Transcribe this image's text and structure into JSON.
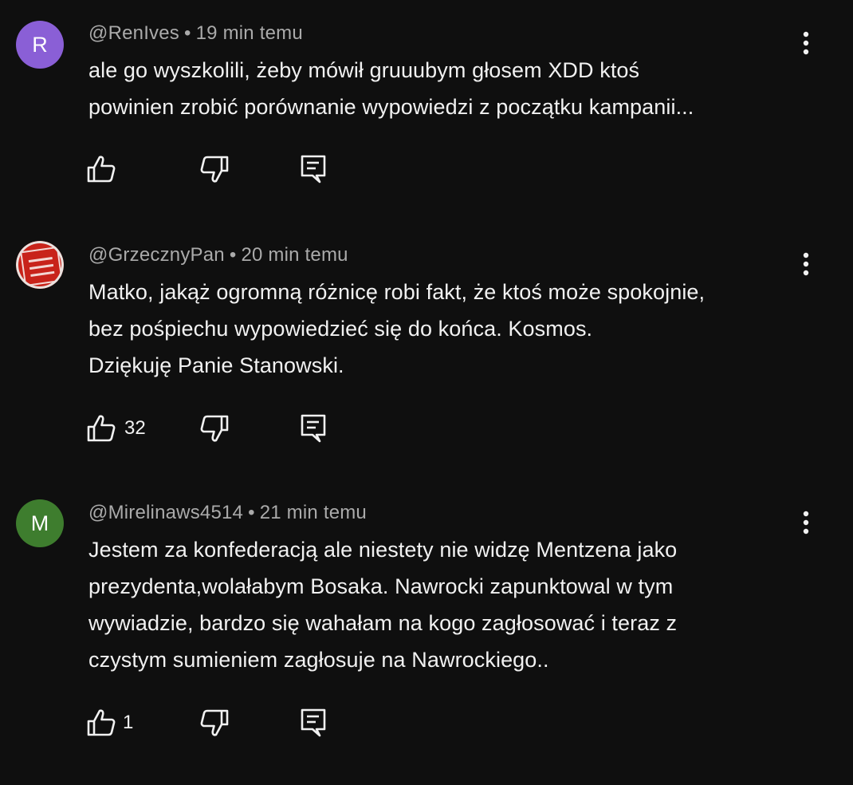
{
  "comments": [
    {
      "avatar_letter": "R",
      "avatar_color": "#8a5fd6",
      "author": "@RenIves",
      "separator": "•",
      "time": "19 min temu",
      "lines": [
        "ale go wyszkolili, żeby mówił gruuubym głosem XDD ktoś",
        "powinien zrobić porównanie wypowiedzi z początku kampanii..."
      ],
      "likes": "",
      "icons": {
        "like": "thumb-up-icon",
        "dislike": "thumb-down-icon",
        "reply": "reply-icon",
        "menu": "more-vert-icon"
      }
    },
    {
      "avatar_letter": "",
      "avatar_color": "#c8231a",
      "author": "@GrzecznyPan",
      "separator": "•",
      "time": "20 min temu",
      "lines": [
        "Matko, jakąż ogromną różnicę robi fakt, że ktoś może spokojnie,",
        "bez pośpiechu wypowiedzieć się do końca. Kosmos.",
        "Dziękuję Panie Stanowski."
      ],
      "likes": "32",
      "icons": {
        "like": "thumb-up-icon",
        "dislike": "thumb-down-icon",
        "reply": "reply-icon",
        "menu": "more-vert-icon"
      }
    },
    {
      "avatar_letter": "M",
      "avatar_color": "#3e7d2e",
      "author": "@Mirelinaws4514",
      "separator": "•",
      "time": "21 min temu",
      "lines": [
        "Jestem za konfederacją ale niestety nie widzę Mentzena jako",
        "prezydenta,wolałabym Bosaka. Nawrocki zapunktowal w tym",
        "wywiadzie, bardzo się wahałam na kogo zagłosować i teraz z",
        "czystym sumieniem zagłosuje na Nawrockiego.."
      ],
      "likes": "1",
      "icons": {
        "like": "thumb-up-icon",
        "dislike": "thumb-down-icon",
        "reply": "reply-icon",
        "menu": "more-vert-icon"
      }
    }
  ],
  "colors": {
    "background": "#0f0f0f",
    "text": "#f1f1f1",
    "meta": "#aaaaaa"
  }
}
